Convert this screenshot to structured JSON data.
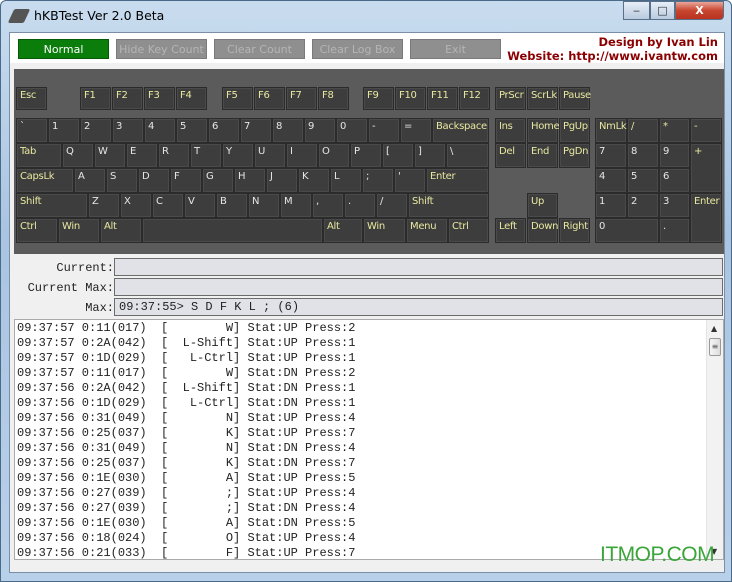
{
  "window": {
    "title": "hKBTest Ver 2.0 Beta",
    "minimize": "‒",
    "maximize": "□",
    "close": "X"
  },
  "toolbar": {
    "buttons": [
      {
        "label": "Normal",
        "active": true
      },
      {
        "label": "Hide Key Count",
        "active": false
      },
      {
        "label": "Clear Count",
        "active": false
      },
      {
        "label": "Clear Log Box",
        "active": false
      },
      {
        "label": "Exit",
        "active": false
      }
    ],
    "credit_line1": "Design by Ivan Lin",
    "credit_line2": "Website: http://www.ivantw.com"
  },
  "keyboard": {
    "fn": [
      "Esc",
      "F1",
      "F2",
      "F3",
      "F4",
      "F5",
      "F6",
      "F7",
      "F8",
      "F9",
      "F10",
      "F11",
      "F12",
      "PrScr",
      "ScrLk",
      "Pause"
    ],
    "row1": [
      "`",
      "1",
      "2",
      "3",
      "4",
      "5",
      "6",
      "7",
      "8",
      "9",
      "0",
      "-",
      "=",
      "Backspace",
      "Ins",
      "Home",
      "PgUp",
      "NmLk",
      "/",
      "*",
      "-"
    ],
    "row2": [
      "Tab",
      "Q",
      "W",
      "E",
      "R",
      "T",
      "Y",
      "U",
      "I",
      "O",
      "P",
      "[",
      "]",
      "\\",
      "Del",
      "End",
      "PgDn",
      "7",
      "8",
      "9",
      "+"
    ],
    "row3": [
      "CapsLk",
      "A",
      "S",
      "D",
      "F",
      "G",
      "H",
      "J",
      "K",
      "L",
      ";",
      "'",
      "Enter",
      "4",
      "5",
      "6"
    ],
    "row4": [
      "Shift",
      "Z",
      "X",
      "C",
      "V",
      "B",
      "N",
      "M",
      ",",
      ".",
      "/",
      "Shift",
      "Up",
      "1",
      "2",
      "3",
      "Enter"
    ],
    "row5": [
      "Ctrl",
      "Win",
      "Alt",
      "",
      "Alt",
      "Win",
      "Menu",
      "Ctrl",
      "Left",
      "Down",
      "Right",
      "0",
      "."
    ]
  },
  "fields": {
    "current_label": "Current:",
    "current_value": "",
    "current_max_label": "Current Max:",
    "current_max_value": "",
    "max_label": "Max:",
    "max_value": "09:37:55> S D F K L ; (6)"
  },
  "log": [
    "09:37:57 0:11(017)  [        W] Stat:UP Press:2",
    "09:37:57 0:2A(042)  [  L-Shift] Stat:UP Press:1",
    "09:37:57 0:1D(029)  [   L-Ctrl] Stat:UP Press:1",
    "09:37:57 0:11(017)  [        W] Stat:DN Press:2",
    "09:37:56 0:2A(042)  [  L-Shift] Stat:DN Press:1",
    "09:37:56 0:1D(029)  [   L-Ctrl] Stat:DN Press:1",
    "09:37:56 0:31(049)  [        N] Stat:UP Press:4",
    "09:37:56 0:25(037)  [        K] Stat:UP Press:7",
    "09:37:56 0:31(049)  [        N] Stat:DN Press:4",
    "09:37:56 0:25(037)  [        K] Stat:DN Press:7",
    "09:37:56 0:1E(030)  [        A] Stat:UP Press:5",
    "09:37:56 0:27(039)  [        ;] Stat:UP Press:4",
    "09:37:56 0:27(039)  [        ;] Stat:DN Press:4",
    "09:37:56 0:1E(030)  [        A] Stat:DN Press:5",
    "09:37:56 0:18(024)  [        O] Stat:UP Press:4",
    "09:37:56 0:21(033)  [        F] Stat:UP Press:7"
  ],
  "colors": {
    "accent_active": "#0b7d0b",
    "credit": "#8b0000",
    "key_special": "#e8e8a0",
    "key_normal": "#e6e6e6",
    "keyboard_bg": "#5b5b5b"
  },
  "watermark": "ITMOP.COM"
}
